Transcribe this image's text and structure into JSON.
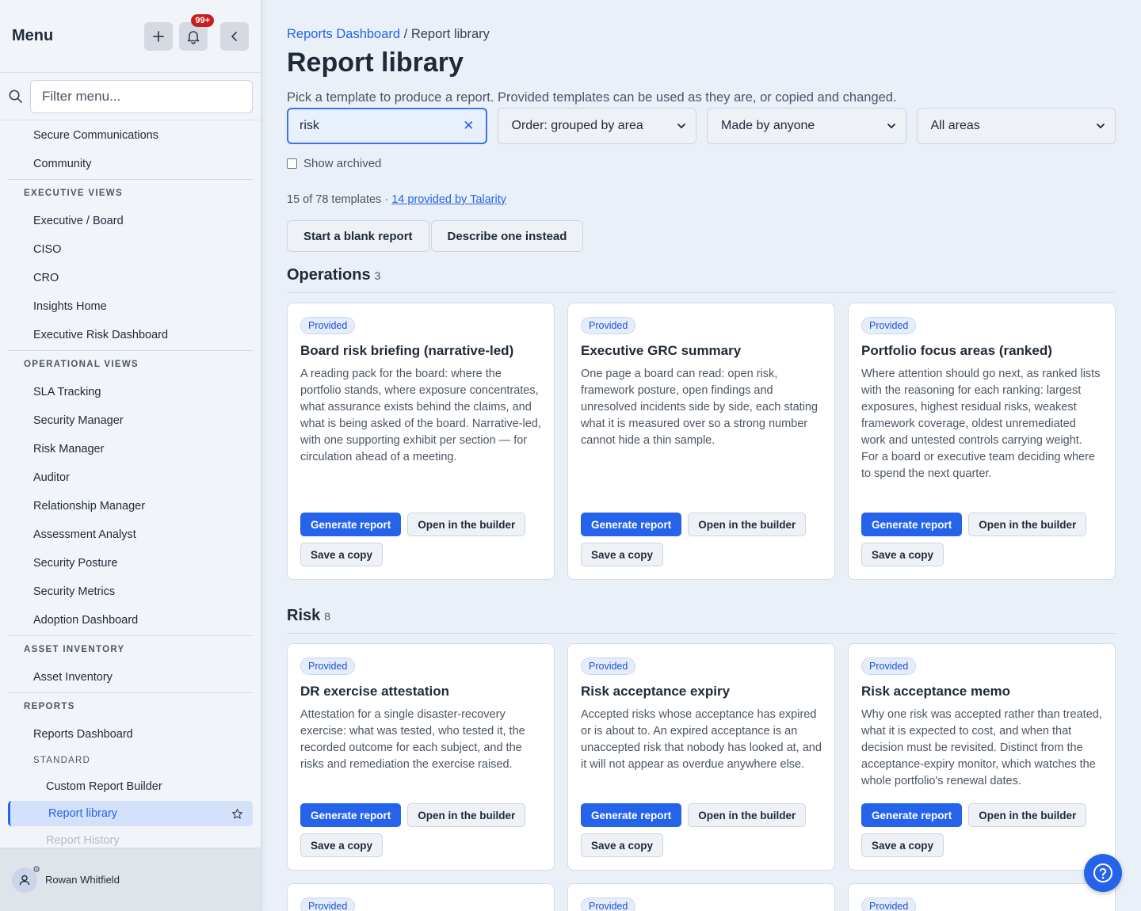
{
  "sidebar": {
    "title": "Menu",
    "notification_count": "99+",
    "filter_placeholder": "Filter menu...",
    "items_top": [
      "Secure Communications",
      "Community"
    ],
    "sections": [
      {
        "title": "EXECUTIVE VIEWS",
        "items": [
          "Executive / Board",
          "CISO",
          "CRO",
          "Insights Home",
          "Executive Risk Dashboard"
        ]
      },
      {
        "title": "OPERATIONAL VIEWS",
        "items": [
          "SLA Tracking",
          "Security Manager",
          "Risk Manager",
          "Auditor",
          "Relationship Manager",
          "Assessment Analyst",
          "Security Posture",
          "Security Metrics",
          "Adoption Dashboard"
        ]
      },
      {
        "title": "ASSET INVENTORY",
        "items": [
          "Asset Inventory"
        ]
      },
      {
        "title": "REPORTS",
        "items": [
          "Reports Dashboard"
        ]
      }
    ],
    "reports_subsection": "STANDARD",
    "reports_sub_items": [
      "Custom Report Builder",
      "Report library",
      "Report History"
    ],
    "active_item": "Report library",
    "user_name": "Rowan Whitfield"
  },
  "main": {
    "breadcrumb_parent": "Reports Dashboard",
    "breadcrumb_sep": " / ",
    "breadcrumb_current": "Report library",
    "title": "Report library",
    "subtitle": "Pick a template to produce a report. Provided templates can be used as they are, or copied and changed.",
    "search_value": "risk",
    "order_select": "Order: grouped by area",
    "author_select": "Made by anyone",
    "area_select": "All areas",
    "show_archived_label": "Show archived",
    "count_text": "15 of 78 templates · ",
    "provided_link": "14 provided by Talarity",
    "start_blank_label": "Start a blank report",
    "describe_label": "Describe one instead"
  },
  "labels": {
    "provided": "Provided",
    "generate": "Generate report",
    "open_builder": "Open in the builder",
    "save_copy": "Save a copy"
  },
  "groups": [
    {
      "name": "Operations",
      "count": "3",
      "cards": [
        {
          "title": "Board risk briefing (narrative-led)",
          "desc": "A reading pack for the board: where the portfolio stands, where exposure concentrates, what assurance exists behind the claims, and what is being asked of the board. Narrative-led, with one supporting exhibit per section — for circulation ahead of a meeting."
        },
        {
          "title": "Executive GRC summary",
          "desc": "One page a board can read: open risk, framework posture, open findings and unresolved incidents side by side, each stating what it is measured over so a strong number cannot hide a thin sample."
        },
        {
          "title": "Portfolio focus areas (ranked)",
          "desc": "Where attention should go next, as ranked lists with the reasoning for each ranking: largest exposures, highest residual risks, weakest framework coverage, oldest unremediated work and untested controls carrying weight. For a board or executive team deciding where to spend the next quarter."
        }
      ]
    },
    {
      "name": "Risk",
      "count": "8",
      "cards": [
        {
          "title": "DR exercise attestation",
          "desc": "Attestation for a single disaster-recovery exercise: what was tested, who tested it, the recorded outcome for each subject, and the risks and remediation the exercise raised."
        },
        {
          "title": "Risk acceptance expiry",
          "desc": "Accepted risks whose acceptance has expired or is about to. An expired acceptance is an unaccepted risk that nobody has looked at, and it will not appear as overdue anywhere else."
        },
        {
          "title": "Risk acceptance memo",
          "desc": "Why one risk was accepted rather than treated, what it is expected to cost, and when that decision must be revisited. Distinct from the acceptance-expiry monitor, which watches the whole portfolio's renewal dates."
        }
      ]
    }
  ]
}
